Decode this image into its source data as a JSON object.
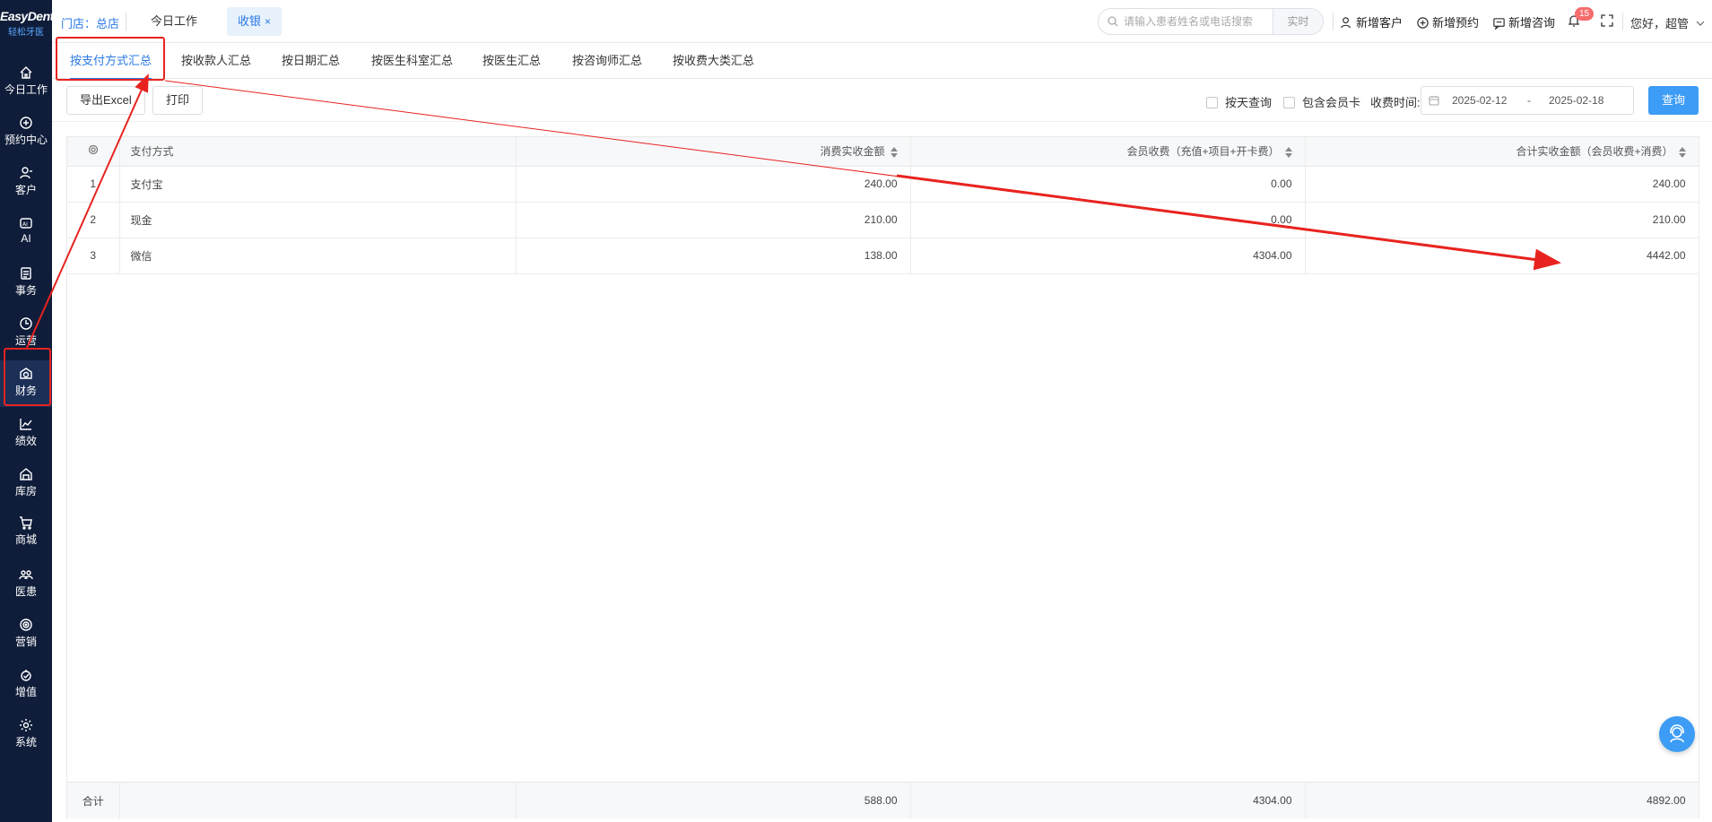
{
  "brand": {
    "logo_text": "EasyDent",
    "logo_sub": "轻松牙医"
  },
  "sidebar": {
    "items": [
      {
        "label": "今日工作",
        "icon": "home-icon"
      },
      {
        "label": "预约中心",
        "icon": "calendar-icon"
      },
      {
        "label": "客户",
        "icon": "user-icon"
      },
      {
        "label": "AI",
        "icon": "ai-icon"
      },
      {
        "label": "事务",
        "icon": "task-icon"
      },
      {
        "label": "运营",
        "icon": "clock-icon"
      },
      {
        "label": "财务",
        "icon": "finance-icon",
        "active": true
      },
      {
        "label": "绩效",
        "icon": "chart-icon"
      },
      {
        "label": "库房",
        "icon": "warehouse-icon"
      },
      {
        "label": "商城",
        "icon": "cart-icon"
      },
      {
        "label": "医患",
        "icon": "doctor-patient-icon"
      },
      {
        "label": "营销",
        "icon": "marketing-icon"
      },
      {
        "label": "增值",
        "icon": "value-added-icon"
      },
      {
        "label": "系统",
        "icon": "gear-icon"
      }
    ]
  },
  "header": {
    "store_label": "门店：总店",
    "tabs": [
      {
        "label": "今日工作"
      },
      {
        "label": "收银",
        "close": "×"
      }
    ],
    "search": {
      "placeholder": "请输入患者姓名或电话搜索",
      "realtime_label": "实时"
    },
    "quick_actions": {
      "new_customer": "新增客户",
      "new_appointment": "新增预约",
      "new_consult": "新增咨询"
    },
    "notifications_count": "15",
    "greeting": "您好，超管"
  },
  "subtabs": [
    "按支付方式汇总",
    "按收款人汇总",
    "按日期汇总",
    "按医生科室汇总",
    "按医生汇总",
    "按咨询师汇总",
    "按收费大类汇总"
  ],
  "toolbar": {
    "export_label": "导出Excel",
    "print_label": "打印",
    "by_day_label": "按天查询",
    "include_card_label": "包含会员卡",
    "fee_time_label": "收费时间:",
    "date_start": "2025-02-12",
    "date_sep": "-",
    "date_end": "2025-02-18",
    "query_label": "查询"
  },
  "table": {
    "columns": [
      "支付方式",
      "消费实收金额",
      "会员收费（充值+项目+开卡费）",
      "合计实收金额（会员收费+消费）"
    ],
    "rows": [
      {
        "idx": "1",
        "method": "支付宝",
        "consume": "240.00",
        "member": "0.00",
        "total": "240.00"
      },
      {
        "idx": "2",
        "method": "现金",
        "consume": "210.00",
        "member": "0.00",
        "total": "210.00"
      },
      {
        "idx": "3",
        "method": "微信",
        "consume": "138.00",
        "member": "4304.00",
        "total": "4442.00"
      }
    ],
    "footer": {
      "label": "合计",
      "consume": "588.00",
      "member": "4304.00",
      "total": "4892.00"
    }
  },
  "colors": {
    "accent": "#2a7ae4",
    "sidebar_bg": "#0f1d3a",
    "annotation": "#e8231f",
    "badge": "#f56c6c"
  }
}
